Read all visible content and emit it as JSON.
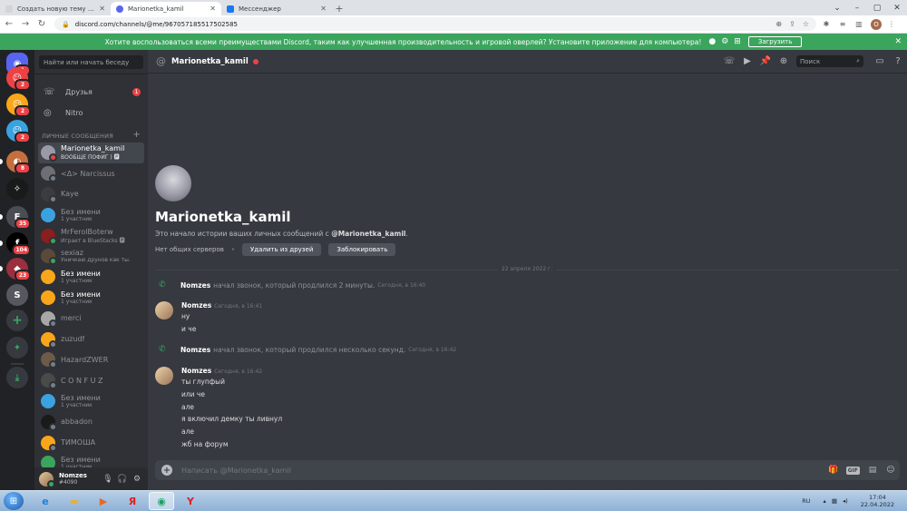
{
  "browser": {
    "tabs": [
      {
        "title": "Создать новую тему - ReallyWo...",
        "favicon_color": "#d4d4d4",
        "active": false
      },
      {
        "title": "Marionetka_kamil",
        "favicon_color": "#5865f2",
        "active": true
      },
      {
        "title": "Мессенджер",
        "favicon_color": "#1877f2",
        "active": false
      }
    ],
    "url": "discord.com/channels/@me/967057185517502585",
    "profile_initial": "O"
  },
  "banner": {
    "text": "Хотите воспользоваться всеми преимуществами Discord, таким как улучшенная производительность и игровой оверлей? Установите приложение для компьютера!",
    "button": "Загрузить",
    "os_icons": [
      "",
      "⚙",
      "⊞"
    ]
  },
  "servers": [
    {
      "label": "",
      "color": "#5865f2",
      "badge": "1",
      "glyph": "◉"
    },
    {
      "label": "",
      "color": "#ed4245",
      "badge": "2",
      "glyph": "☺"
    },
    {
      "label": "",
      "color": "#faa61a",
      "badge": "2",
      "glyph": "☺"
    },
    {
      "label": "",
      "color": "#3ba2e0",
      "badge": "2",
      "glyph": "☺"
    },
    {
      "label": "",
      "color": "#c56f3c",
      "badge": "8",
      "glyph": "◐"
    },
    {
      "label": "",
      "color": "#1a1a1a",
      "badge": "",
      "glyph": "✧"
    },
    {
      "label": "",
      "color": "#4a4d54",
      "badge": "35",
      "glyph": "F"
    },
    {
      "label": "",
      "color": "#000000",
      "badge": "104",
      "glyph": "ƒ"
    },
    {
      "label": "",
      "color": "#9a2f3d",
      "badge": "23",
      "glyph": "◆"
    },
    {
      "label": "",
      "color": "#55585f",
      "badge": "",
      "glyph": "S"
    }
  ],
  "rail_actions": {
    "add": "+",
    "explore": "✦",
    "download": "⤓"
  },
  "dm_sidebar": {
    "search_placeholder": "Найти или начать беседу",
    "friends_label": "Друзья",
    "friends_badge": "1",
    "nitro_label": "Nitro",
    "section_title": "ЛИЧНЫЕ СООБЩЕНИЯ",
    "section_add": "+",
    "items": [
      {
        "name": "Marionetka_kamil",
        "sub": "ВООБЩЕ ПОФИГ ) 🅿",
        "color": "#9a9aa6",
        "status": "#ed4245",
        "active": true,
        "bright": true
      },
      {
        "name": "<Δ> Narcissus",
        "sub": "",
        "color": "#6d6f75",
        "status": "#747f8d",
        "active": false,
        "bright": false
      },
      {
        "name": "Kaye",
        "sub": "",
        "color": "#3a3c40",
        "status": "#747f8d",
        "active": false,
        "bright": false
      },
      {
        "name": "Без имени",
        "sub": "1 участник",
        "color": "#3ba2e0",
        "status": "",
        "active": false,
        "bright": false
      },
      {
        "name": "MrFerolBoterw",
        "sub": "Играет в BlueStacks 🅿",
        "color": "#8b1e1e",
        "status": "#3ba55d",
        "active": false,
        "bright": false
      },
      {
        "name": "sexiaz",
        "sub": "Уничкаю друнов как ты.",
        "color": "#5a4a3a",
        "status": "#3ba55d",
        "active": false,
        "bright": false
      },
      {
        "name": "Без имени",
        "sub": "1 участник",
        "color": "#faa61a",
        "status": "",
        "active": false,
        "bright": true
      },
      {
        "name": "Без имени",
        "sub": "1 участник",
        "color": "#faa61a",
        "status": "",
        "active": false,
        "bright": true
      },
      {
        "name": "merci",
        "sub": "",
        "color": "#a8a8a8",
        "status": "#747f8d",
        "active": false,
        "bright": false
      },
      {
        "name": "zuzudf",
        "sub": "",
        "color": "#faa61a",
        "status": "#747f8d",
        "active": false,
        "bright": false
      },
      {
        "name": "HazardZWER",
        "sub": "",
        "color": "#6d5a49",
        "status": "#747f8d",
        "active": false,
        "bright": false
      },
      {
        "name": "C O N F U Z",
        "sub": "",
        "color": "#4a4a4a",
        "status": "#747f8d",
        "active": false,
        "bright": false
      },
      {
        "name": "Без имени",
        "sub": "1 участник",
        "color": "#3ba2e0",
        "status": "",
        "active": false,
        "bright": false
      },
      {
        "name": "abbadon",
        "sub": "",
        "color": "#1a1a1a",
        "status": "#747f8d",
        "active": false,
        "bright": false
      },
      {
        "name": "ТИМОША",
        "sub": "",
        "color": "#faa61a",
        "status": "#747f8d",
        "active": false,
        "bright": false
      },
      {
        "name": "Без имени",
        "sub": "1 участник",
        "color": "#3ba55d",
        "status": "",
        "active": false,
        "bright": false
      }
    ]
  },
  "user_panel": {
    "name": "Nomzes",
    "tag": "#4090"
  },
  "chat": {
    "recipient": "Marionetka_kamil",
    "search_placeholder": "Поиск",
    "welcome_title": "Marionetka_kamil",
    "welcome_text_prefix": "Это начало истории ваших личных сообщений с ",
    "welcome_text_name": "@Marionetka_kamil",
    "welcome_text_suffix": ".",
    "no_common_servers": "Нет общих серверов",
    "remove_friend": "Удалить из друзей",
    "block": "Заблокировать",
    "date_separator": "22 апреля 2022 г.",
    "system1": {
      "author": "Nomzes",
      "text": "начал звонок, который продлился 2 минуты.",
      "time": "Сегодня, в 16:40"
    },
    "msg1": {
      "author": "Nomzes",
      "time": "Сегодня, в 16:41",
      "lines": [
        "ну",
        "и че"
      ]
    },
    "system2": {
      "author": "Nomzes",
      "text": "начал звонок, который продлился несколько секунд.",
      "time": "Сегодня, в 16:42"
    },
    "msg2": {
      "author": "Nomzes",
      "time": "Сегодня, в 16:42",
      "lines": [
        "ты глупфый",
        "или че",
        "але",
        "я включил демку ты ливнул",
        "але",
        "жб на форум"
      ]
    },
    "composer_placeholder": "Написать @Marionetka_kamil",
    "gif_label": "GIF"
  },
  "taskbar": {
    "lang": "RU",
    "time": "17:04",
    "date": "22.04.2022"
  }
}
